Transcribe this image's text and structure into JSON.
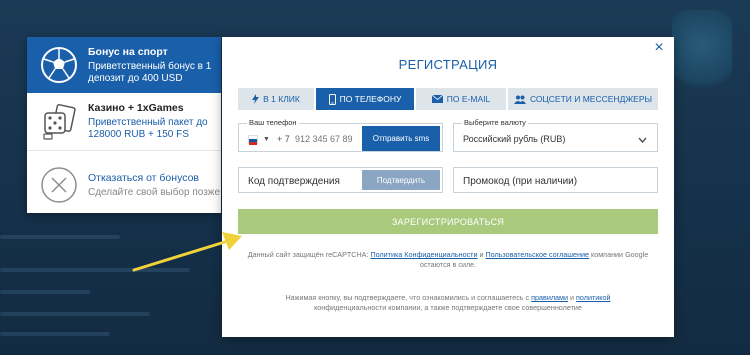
{
  "colors": {
    "brand": "#1a5faa",
    "register": "#a9c97d",
    "arrow": "#f0d23a"
  },
  "bonuses": [
    {
      "icon": "soccer-ball-icon",
      "title": "Бонус на спорт",
      "desc": "Приветственный бонус в 1 депозит до 400 USD"
    },
    {
      "icon": "casino-cards-icon",
      "title": "Казино + 1xGames",
      "desc": "Приветственный пакет до 128000 RUB + 150 FS"
    },
    {
      "icon": "decline-x-icon",
      "title": "Отказаться от бонусов",
      "desc": "Сделайте свой выбор позже"
    }
  ],
  "modal": {
    "title": "РЕГИСТРАЦИЯ",
    "close": "×",
    "tabs": [
      {
        "icon": "lightning-icon",
        "label": "В 1 КЛИК"
      },
      {
        "icon": "phone-icon",
        "label": "ПО ТЕЛЕФОНУ"
      },
      {
        "icon": "envelope-icon",
        "label": "ПО E-MAIL"
      },
      {
        "icon": "people-icon",
        "label": "СОЦСЕТИ И МЕССЕНДЖЕРЫ"
      }
    ],
    "phone": {
      "label": "Ваш телефон",
      "code": "+ 7",
      "placeholder": "912 345 67 89",
      "sms_button": "Отправить sms"
    },
    "currency": {
      "label": "Выберите валюту",
      "value": "Российский рубль (RUB)"
    },
    "code": {
      "placeholder": "Код подтверждения",
      "confirm_button": "Подтвердить"
    },
    "promo": {
      "placeholder": "Промокод (при наличии)"
    },
    "register_button": "ЗАРЕГИСТРИРОВАТЬСЯ",
    "captcha": {
      "prefix": "Данный сайт защищён reCAPTCHA:",
      "privacy_link": "Политика Конфиденциальности",
      "and": "и",
      "terms_link": "Пользовательское соглашение",
      "suffix": "компании Google остаются в силе."
    },
    "terms": {
      "prefix": "Нажимая кнопку, вы подтверждаете, что ознакомились и соглашаетесь с",
      "rules_link": "правилами",
      "and": "и",
      "policy_link": "политикой",
      "suffix": "конфиденциальности компании, а также подтверждаете свое совершеннолетие"
    }
  }
}
